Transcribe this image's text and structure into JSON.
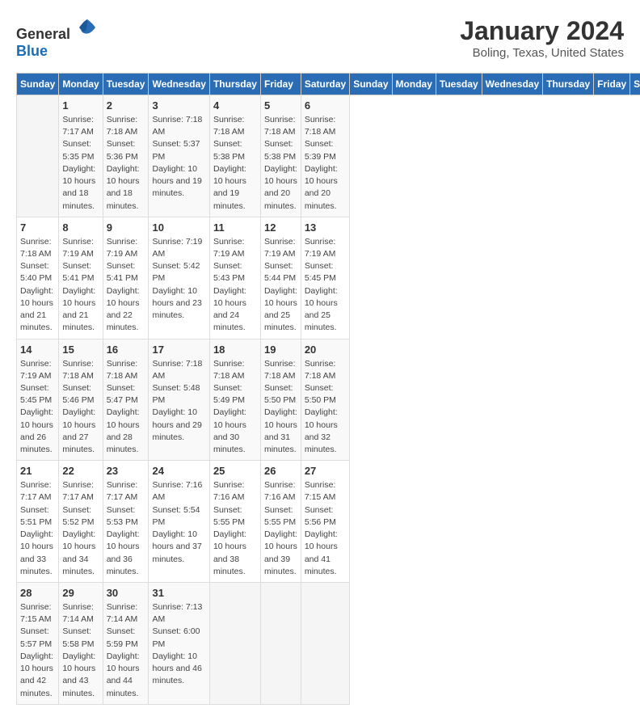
{
  "header": {
    "logo_general": "General",
    "logo_blue": "Blue",
    "title": "January 2024",
    "subtitle": "Boling, Texas, United States"
  },
  "columns": [
    "Sunday",
    "Monday",
    "Tuesday",
    "Wednesday",
    "Thursday",
    "Friday",
    "Saturday"
  ],
  "weeks": [
    [
      {
        "day": "",
        "sunrise": "",
        "sunset": "",
        "daylight": ""
      },
      {
        "day": "1",
        "sunrise": "Sunrise: 7:17 AM",
        "sunset": "Sunset: 5:35 PM",
        "daylight": "Daylight: 10 hours and 18 minutes."
      },
      {
        "day": "2",
        "sunrise": "Sunrise: 7:18 AM",
        "sunset": "Sunset: 5:36 PM",
        "daylight": "Daylight: 10 hours and 18 minutes."
      },
      {
        "day": "3",
        "sunrise": "Sunrise: 7:18 AM",
        "sunset": "Sunset: 5:37 PM",
        "daylight": "Daylight: 10 hours and 19 minutes."
      },
      {
        "day": "4",
        "sunrise": "Sunrise: 7:18 AM",
        "sunset": "Sunset: 5:38 PM",
        "daylight": "Daylight: 10 hours and 19 minutes."
      },
      {
        "day": "5",
        "sunrise": "Sunrise: 7:18 AM",
        "sunset": "Sunset: 5:38 PM",
        "daylight": "Daylight: 10 hours and 20 minutes."
      },
      {
        "day": "6",
        "sunrise": "Sunrise: 7:18 AM",
        "sunset": "Sunset: 5:39 PM",
        "daylight": "Daylight: 10 hours and 20 minutes."
      }
    ],
    [
      {
        "day": "7",
        "sunrise": "Sunrise: 7:18 AM",
        "sunset": "Sunset: 5:40 PM",
        "daylight": "Daylight: 10 hours and 21 minutes."
      },
      {
        "day": "8",
        "sunrise": "Sunrise: 7:19 AM",
        "sunset": "Sunset: 5:41 PM",
        "daylight": "Daylight: 10 hours and 21 minutes."
      },
      {
        "day": "9",
        "sunrise": "Sunrise: 7:19 AM",
        "sunset": "Sunset: 5:41 PM",
        "daylight": "Daylight: 10 hours and 22 minutes."
      },
      {
        "day": "10",
        "sunrise": "Sunrise: 7:19 AM",
        "sunset": "Sunset: 5:42 PM",
        "daylight": "Daylight: 10 hours and 23 minutes."
      },
      {
        "day": "11",
        "sunrise": "Sunrise: 7:19 AM",
        "sunset": "Sunset: 5:43 PM",
        "daylight": "Daylight: 10 hours and 24 minutes."
      },
      {
        "day": "12",
        "sunrise": "Sunrise: 7:19 AM",
        "sunset": "Sunset: 5:44 PM",
        "daylight": "Daylight: 10 hours and 25 minutes."
      },
      {
        "day": "13",
        "sunrise": "Sunrise: 7:19 AM",
        "sunset": "Sunset: 5:45 PM",
        "daylight": "Daylight: 10 hours and 25 minutes."
      }
    ],
    [
      {
        "day": "14",
        "sunrise": "Sunrise: 7:19 AM",
        "sunset": "Sunset: 5:45 PM",
        "daylight": "Daylight: 10 hours and 26 minutes."
      },
      {
        "day": "15",
        "sunrise": "Sunrise: 7:18 AM",
        "sunset": "Sunset: 5:46 PM",
        "daylight": "Daylight: 10 hours and 27 minutes."
      },
      {
        "day": "16",
        "sunrise": "Sunrise: 7:18 AM",
        "sunset": "Sunset: 5:47 PM",
        "daylight": "Daylight: 10 hours and 28 minutes."
      },
      {
        "day": "17",
        "sunrise": "Sunrise: 7:18 AM",
        "sunset": "Sunset: 5:48 PM",
        "daylight": "Daylight: 10 hours and 29 minutes."
      },
      {
        "day": "18",
        "sunrise": "Sunrise: 7:18 AM",
        "sunset": "Sunset: 5:49 PM",
        "daylight": "Daylight: 10 hours and 30 minutes."
      },
      {
        "day": "19",
        "sunrise": "Sunrise: 7:18 AM",
        "sunset": "Sunset: 5:50 PM",
        "daylight": "Daylight: 10 hours and 31 minutes."
      },
      {
        "day": "20",
        "sunrise": "Sunrise: 7:18 AM",
        "sunset": "Sunset: 5:50 PM",
        "daylight": "Daylight: 10 hours and 32 minutes."
      }
    ],
    [
      {
        "day": "21",
        "sunrise": "Sunrise: 7:17 AM",
        "sunset": "Sunset: 5:51 PM",
        "daylight": "Daylight: 10 hours and 33 minutes."
      },
      {
        "day": "22",
        "sunrise": "Sunrise: 7:17 AM",
        "sunset": "Sunset: 5:52 PM",
        "daylight": "Daylight: 10 hours and 34 minutes."
      },
      {
        "day": "23",
        "sunrise": "Sunrise: 7:17 AM",
        "sunset": "Sunset: 5:53 PM",
        "daylight": "Daylight: 10 hours and 36 minutes."
      },
      {
        "day": "24",
        "sunrise": "Sunrise: 7:16 AM",
        "sunset": "Sunset: 5:54 PM",
        "daylight": "Daylight: 10 hours and 37 minutes."
      },
      {
        "day": "25",
        "sunrise": "Sunrise: 7:16 AM",
        "sunset": "Sunset: 5:55 PM",
        "daylight": "Daylight: 10 hours and 38 minutes."
      },
      {
        "day": "26",
        "sunrise": "Sunrise: 7:16 AM",
        "sunset": "Sunset: 5:55 PM",
        "daylight": "Daylight: 10 hours and 39 minutes."
      },
      {
        "day": "27",
        "sunrise": "Sunrise: 7:15 AM",
        "sunset": "Sunset: 5:56 PM",
        "daylight": "Daylight: 10 hours and 41 minutes."
      }
    ],
    [
      {
        "day": "28",
        "sunrise": "Sunrise: 7:15 AM",
        "sunset": "Sunset: 5:57 PM",
        "daylight": "Daylight: 10 hours and 42 minutes."
      },
      {
        "day": "29",
        "sunrise": "Sunrise: 7:14 AM",
        "sunset": "Sunset: 5:58 PM",
        "daylight": "Daylight: 10 hours and 43 minutes."
      },
      {
        "day": "30",
        "sunrise": "Sunrise: 7:14 AM",
        "sunset": "Sunset: 5:59 PM",
        "daylight": "Daylight: 10 hours and 44 minutes."
      },
      {
        "day": "31",
        "sunrise": "Sunrise: 7:13 AM",
        "sunset": "Sunset: 6:00 PM",
        "daylight": "Daylight: 10 hours and 46 minutes."
      },
      {
        "day": "",
        "sunrise": "",
        "sunset": "",
        "daylight": ""
      },
      {
        "day": "",
        "sunrise": "",
        "sunset": "",
        "daylight": ""
      },
      {
        "day": "",
        "sunrise": "",
        "sunset": "",
        "daylight": ""
      }
    ]
  ]
}
